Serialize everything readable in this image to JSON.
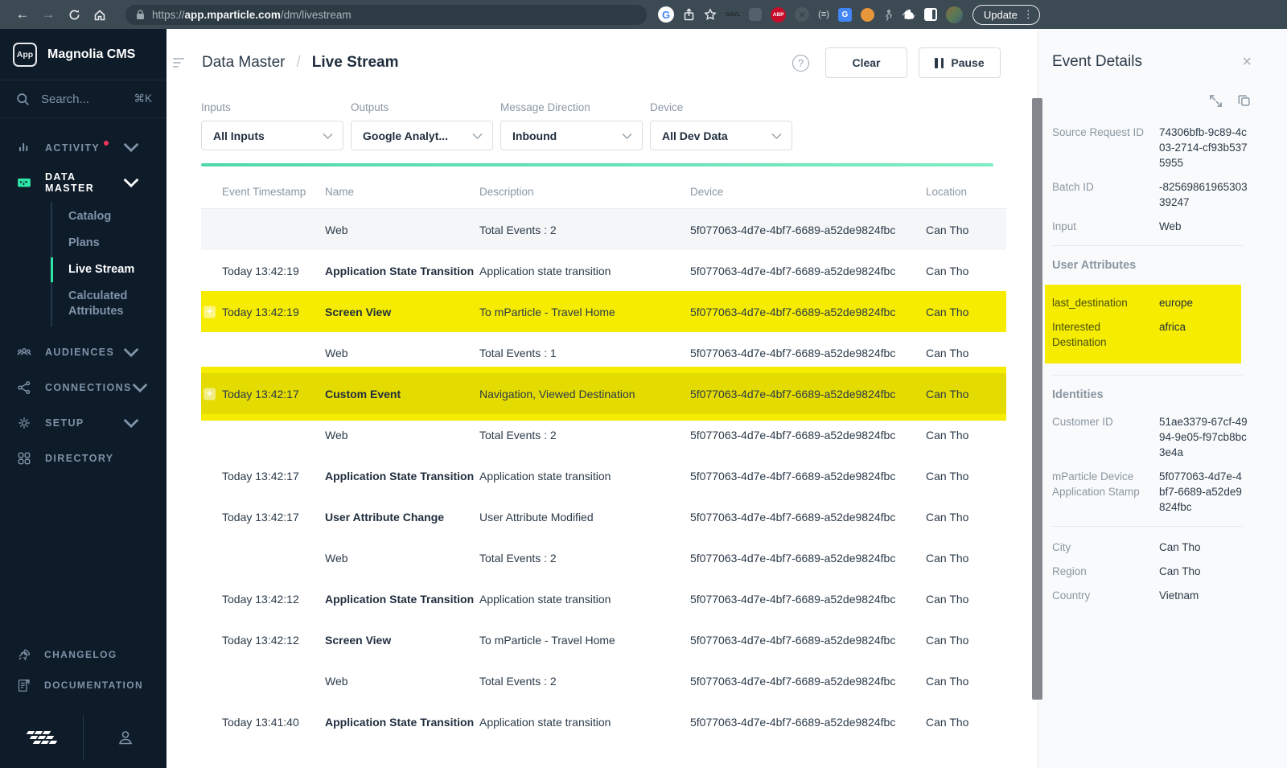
{
  "browser": {
    "url_scheme": "https://",
    "url_host": "app.mparticle.com",
    "url_path": "/dm/livestream",
    "ext_savl": "SAVL",
    "ext_abp": "ABP",
    "ext_paren": "(≡)",
    "update_label": "Update"
  },
  "sidebar": {
    "logo_badge": "App",
    "app_title": "Magnolia CMS",
    "search_placeholder": "Search...",
    "search_shortcut": "⌘K",
    "items": [
      {
        "label": "ACTIVITY"
      },
      {
        "label": "DATA MASTER"
      },
      {
        "label": "AUDIENCES"
      },
      {
        "label": "CONNECTIONS"
      },
      {
        "label": "SETUP"
      },
      {
        "label": "DIRECTORY"
      }
    ],
    "data_master_sub": [
      {
        "label": "Catalog"
      },
      {
        "label": "Plans"
      },
      {
        "label": "Live Stream"
      },
      {
        "label": "Calculated Attributes"
      }
    ],
    "footer_links": [
      {
        "label": "CHANGELOG"
      },
      {
        "label": "DOCUMENTATION"
      }
    ]
  },
  "header": {
    "breadcrumb_parent": "Data Master",
    "breadcrumb_sep": "/",
    "breadcrumb_current": "Live Stream",
    "clear_label": "Clear",
    "pause_label": "Pause"
  },
  "filters": [
    {
      "label": "Inputs",
      "value": "All Inputs"
    },
    {
      "label": "Outputs",
      "value": "Google Analyt..."
    },
    {
      "label": "Message Direction",
      "value": "Inbound"
    },
    {
      "label": "Device",
      "value": "All Dev Data"
    }
  ],
  "table": {
    "columns": [
      "Event Timestamp",
      "Name",
      "Description",
      "Device",
      "Location"
    ],
    "device_id": "5f077063-4d7e-4bf7-6689-a52de9824fbc",
    "rows": [
      {
        "timestamp": "",
        "name": "Web",
        "bold": false,
        "description": "Total Events : 2",
        "location": "Can Tho",
        "style": "gray",
        "plus": false
      },
      {
        "timestamp": "Today 13:42:19",
        "name": "Application State Transition",
        "bold": true,
        "description": "Application state transition",
        "location": "Can Tho",
        "style": "plain",
        "plus": false
      },
      {
        "timestamp": "Today 13:42:19",
        "name": "Screen View",
        "bold": true,
        "description": "To mParticle - Travel Home",
        "location": "Can Tho",
        "style": "yellow",
        "plus": true
      },
      {
        "timestamp": "",
        "name": "Web",
        "bold": false,
        "description": "Total Events : 1",
        "location": "Can Tho",
        "style": "plain",
        "plus": false
      },
      {
        "timestamp": "Today 13:42:17",
        "name": "Custom Event",
        "bold": true,
        "description": "Navigation, Viewed Destination",
        "location": "Can Tho",
        "style": "yellow-selected",
        "plus": true
      },
      {
        "timestamp": "",
        "name": "Web",
        "bold": false,
        "description": "Total Events : 2",
        "location": "Can Tho",
        "style": "plain",
        "plus": false
      },
      {
        "timestamp": "Today 13:42:17",
        "name": "Application State Transition",
        "bold": true,
        "description": "Application state transition",
        "location": "Can Tho",
        "style": "plain",
        "plus": false
      },
      {
        "timestamp": "Today 13:42:17",
        "name": "User Attribute Change",
        "bold": true,
        "description": "User Attribute Modified",
        "location": "Can Tho",
        "style": "plain",
        "plus": false
      },
      {
        "timestamp": "",
        "name": "Web",
        "bold": false,
        "description": "Total Events : 2",
        "location": "Can Tho",
        "style": "plain",
        "plus": false
      },
      {
        "timestamp": "Today 13:42:12",
        "name": "Application State Transition",
        "bold": true,
        "description": "Application state transition",
        "location": "Can Tho",
        "style": "plain",
        "plus": false
      },
      {
        "timestamp": "Today 13:42:12",
        "name": "Screen View",
        "bold": true,
        "description": "To mParticle - Travel Home",
        "location": "Can Tho",
        "style": "plain",
        "plus": true
      },
      {
        "timestamp": "",
        "name": "Web",
        "bold": false,
        "description": "Total Events : 2",
        "location": "Can Tho",
        "style": "plain",
        "plus": false
      },
      {
        "timestamp": "Today 13:41:40",
        "name": "Application State Transition",
        "bold": true,
        "description": "Application state transition",
        "location": "Can Tho",
        "style": "plain",
        "plus": false
      }
    ]
  },
  "panel": {
    "title": "Event Details",
    "request_fields": [
      {
        "label": "Source Request ID",
        "value": "74306bfb-9c89-4c03-2714-cf93b5375955"
      },
      {
        "label": "Batch ID",
        "value": "-8256986196530339247"
      },
      {
        "label": "Input",
        "value": "Web"
      }
    ],
    "user_attributes_heading": "User Attributes",
    "user_attributes": [
      {
        "label": "last_destination",
        "value": "europe"
      },
      {
        "label": "Interested Destination",
        "value": "africa"
      }
    ],
    "identities_heading": "Identities",
    "identities": [
      {
        "label": "Customer ID",
        "value": "51ae3379-67cf-4994-9e05-f97cb8bc3e4a"
      },
      {
        "label": "mParticle Device Application Stamp",
        "value": "5f077063-4d7e-4bf7-6689-a52de9824fbc"
      }
    ],
    "location_fields": [
      {
        "label": "City",
        "value": "Can Tho"
      },
      {
        "label": "Region",
        "value": "Can Tho"
      },
      {
        "label": "Country",
        "value": "Vietnam"
      }
    ]
  },
  "colors": {
    "accent_teal": "#2EE6A8",
    "highlight_yellow": "#F6EC00",
    "sidebar_bg": "#0E1B29",
    "alert_red": "#F2355B",
    "browser_bar": "#3C4A53"
  }
}
